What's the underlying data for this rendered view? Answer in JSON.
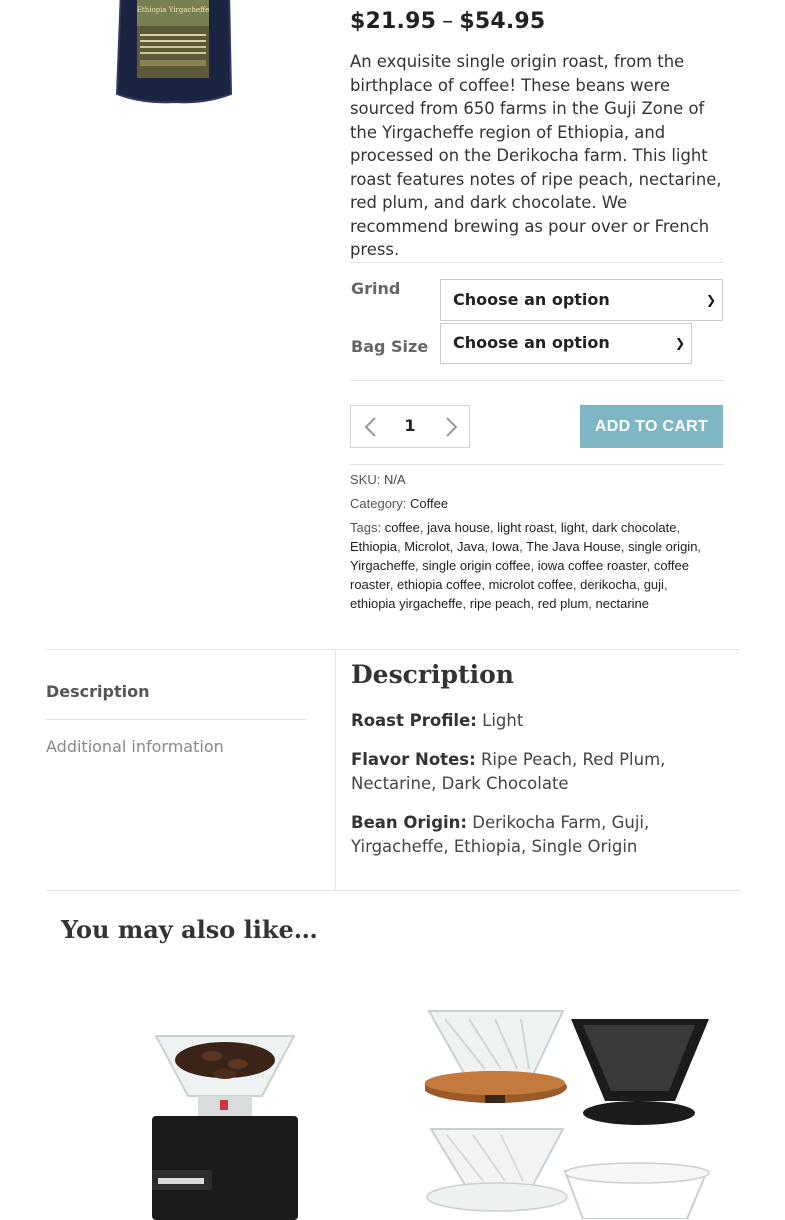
{
  "product": {
    "price_min": "$21.95",
    "price_sep": "–",
    "price_max": "$54.95",
    "description": "An exquisite single origin roast, from the birthplace of coffee! These beans were sourced from 650 farms in the Guji Zone of the Yirgacheffe region of Ethiopia, and processed on the Derikocha farm. This light roast features notes of ripe peach, nectarine, red plum, and dark chocolate. We recommend brewing as pour over or French press.",
    "bag_label": "Ethiopia Yirgacheffe"
  },
  "variations": {
    "grind_label": "Grind",
    "grind_value": "Choose an option",
    "bag_size_label": "Bag Size",
    "bag_size_value": "Choose an option"
  },
  "cart": {
    "quantity": "1",
    "add_label": "ADD TO CART"
  },
  "meta": {
    "sku_label": "SKU:",
    "sku_value": "N/A",
    "category_label": "Category:",
    "category_value": "Coffee",
    "tags_label": "Tags:",
    "tags": [
      "coffee",
      "java house",
      "light roast",
      "light",
      "dark chocolate",
      "Ethiopia",
      "Microlot",
      "Java",
      "Iowa",
      "The Java House",
      "single origin",
      "Yirgacheffe",
      "single origin coffee",
      "iowa coffee roaster",
      "coffee roaster",
      "ethiopia coffee",
      "microlot coffee",
      "derikocha",
      "guji",
      "ethiopia yirgacheffe",
      "ripe peach",
      "red plum",
      "nectarine"
    ]
  },
  "tabs": [
    {
      "label": "Description",
      "active": true
    },
    {
      "label": "Additional information",
      "active": false
    }
  ],
  "panel": {
    "title": "Description",
    "roast_label": "Roast Profile:",
    "roast_value": "Light",
    "flavor_label": "Flavor Notes:",
    "flavor_value": "Ripe Peach, Red Plum, Nectarine, Dark Chocolate",
    "origin_label": "Bean Origin:",
    "origin_value": "Derikocha Farm, Guji, Yirgacheffe, Ethiopia, Single Origin"
  },
  "related": {
    "heading": "You may also like…"
  },
  "colors": {
    "accent_button": "#7fb6c4",
    "divider": "#e3e3e3",
    "bag_navy": "#1b2440"
  }
}
